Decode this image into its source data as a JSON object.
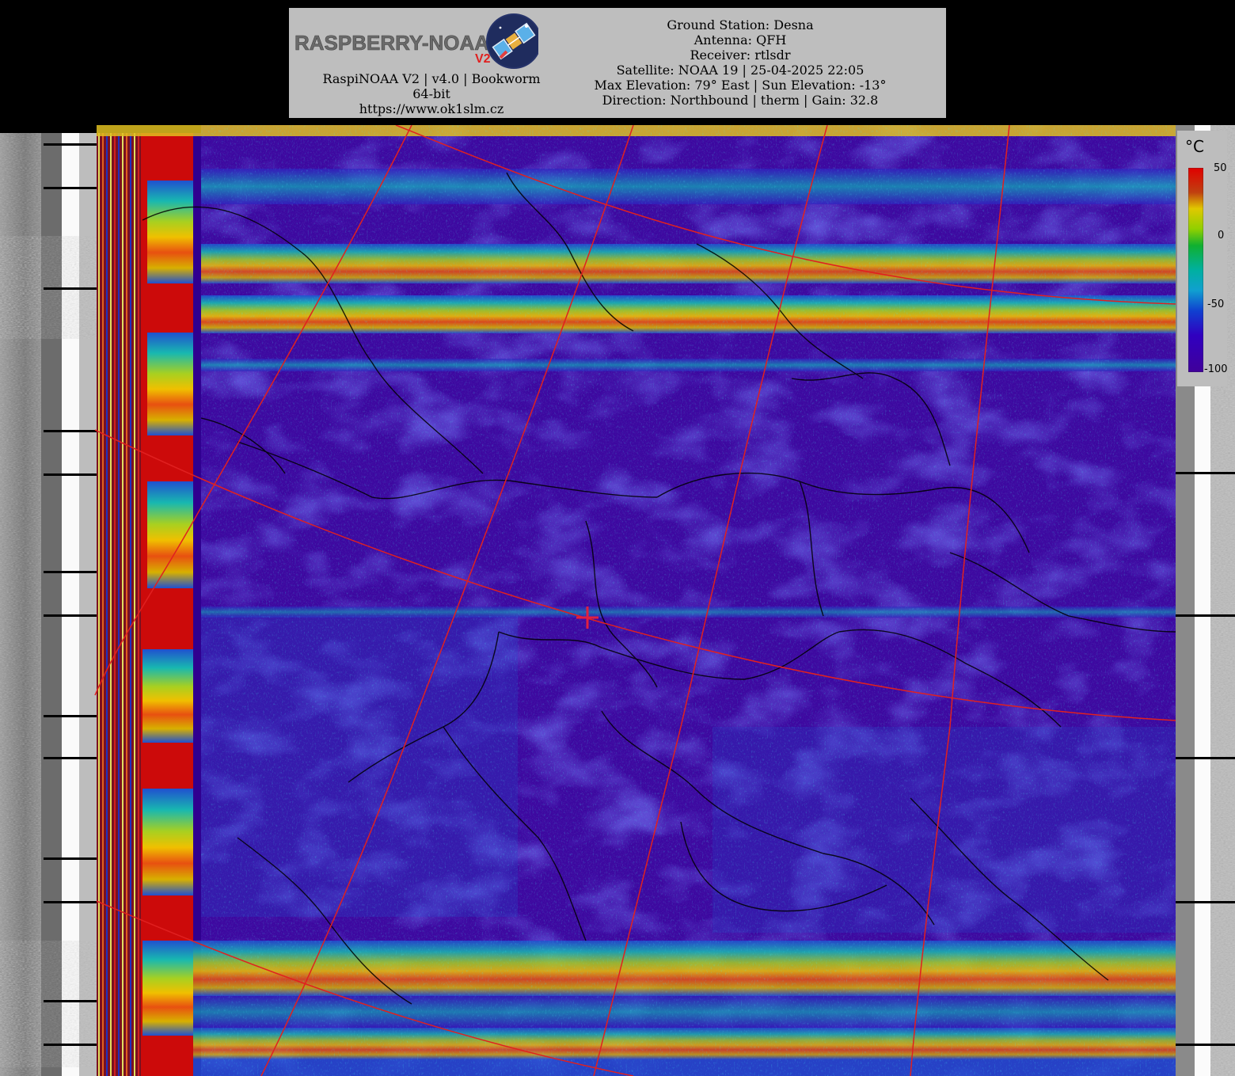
{
  "header": {
    "logo": {
      "text": "RASPBERRY-NOAA",
      "suffix": "V2",
      "icon": "satellite-icon"
    },
    "version_line": "RaspiNOAA V2 | v4.0 | Bookworm 64-bit",
    "url": "https://www.ok1slm.cz",
    "ground_station": "Ground Station: Desna",
    "antenna": "Antenna: QFH",
    "receiver": "Receiver: rtlsdr",
    "satellite": "Satellite: NOAA 19 | 25-04-2025 22:05",
    "elevation": "Max Elevation: 79° East | Sun Elevation: -13°",
    "direction": "Direction: Northbound | therm | Gain: 32.8"
  },
  "scale": {
    "unit": "°C",
    "ticks": [
      "50",
      "0",
      "-50",
      "-100"
    ],
    "colors": [
      "#e00000",
      "#e05a00",
      "#e0c800",
      "#90d000",
      "#10b030",
      "#00b0a0",
      "#10a0d0",
      "#1040d0",
      "#3000c0",
      "#40009a"
    ]
  },
  "image": {
    "type": "NOAA APT thermal (therm) enhanced satellite image",
    "icon": "map-crosshair-icon",
    "colors": {
      "cold": "#3c08a0",
      "band": "#e8d000",
      "hot": "#d81010",
      "grid": "#e02020",
      "border": "#000000"
    }
  }
}
